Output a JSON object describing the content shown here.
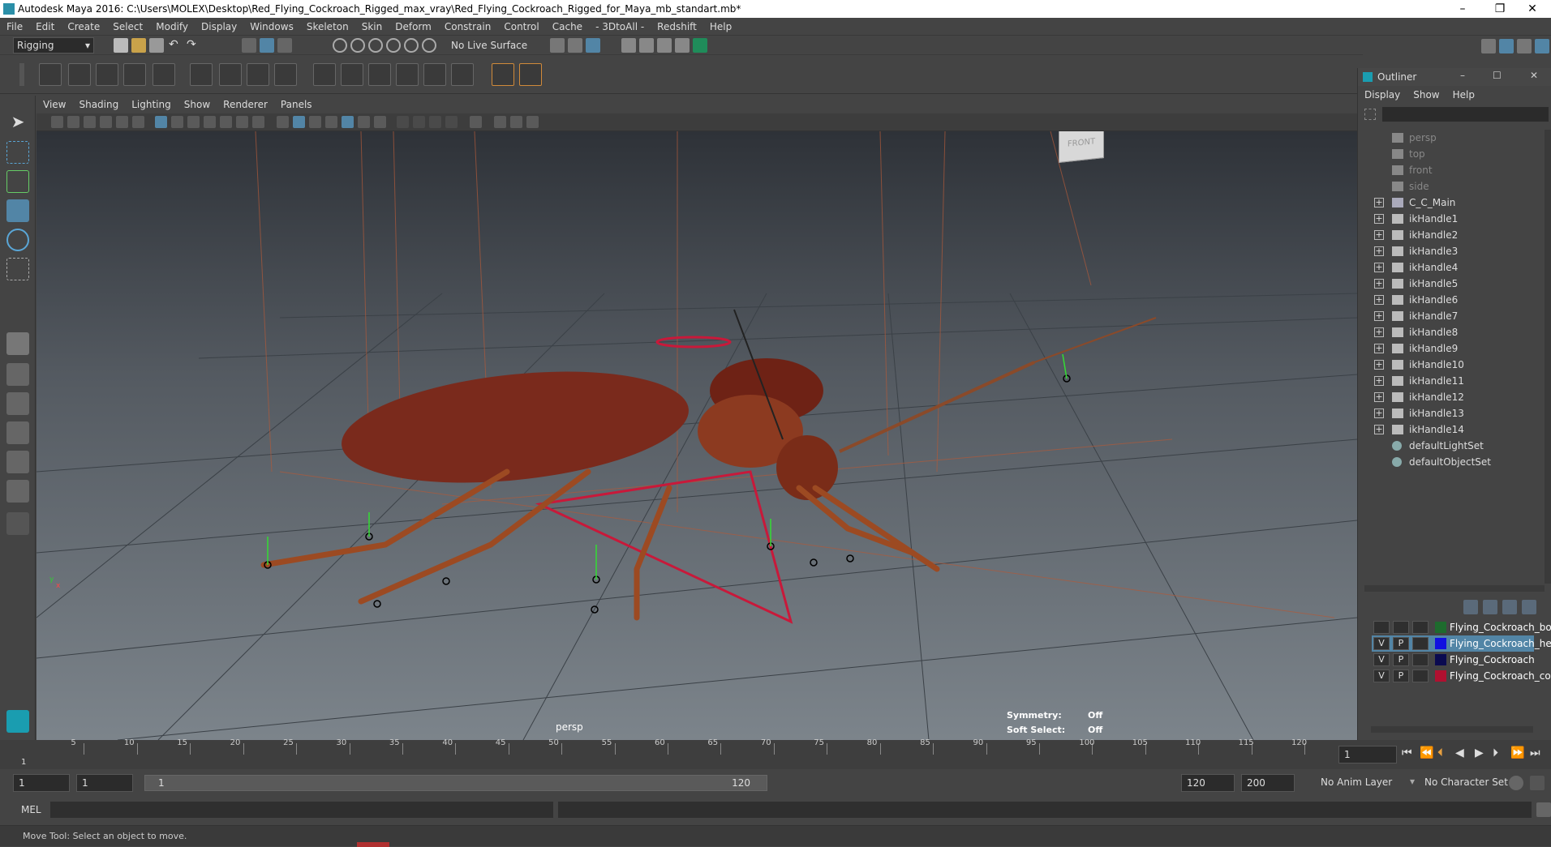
{
  "window": {
    "title": "Autodesk Maya 2016: C:\\Users\\MOLEX\\Desktop\\Red_Flying_Cockroach_Rigged_max_vray\\Red_Flying_Cockroach_Rigged_for_Maya_mb_standart.mb*",
    "minimize": "–",
    "restore": "❐",
    "close": "✕"
  },
  "menubar": [
    "File",
    "Edit",
    "Create",
    "Select",
    "Modify",
    "Display",
    "Windows",
    "Skeleton",
    "Skin",
    "Deform",
    "Constrain",
    "Control",
    "Cache",
    "- 3DtoAll -",
    "Redshift",
    "Help"
  ],
  "statusline": {
    "mode": "Rigging",
    "live_surface": "No Live Surface"
  },
  "viewport": {
    "menu": [
      "View",
      "Shading",
      "Lighting",
      "Show",
      "Renderer",
      "Panels"
    ],
    "camera_label": "persp",
    "viewcube_label": "FRONT",
    "hud": {
      "symmetry_label": "Symmetry:",
      "symmetry_value": "Off",
      "soft_select_label": "Soft Select:",
      "soft_select_value": "Off"
    }
  },
  "outliner": {
    "title": "Outliner",
    "menu": [
      "Display",
      "Show",
      "Help"
    ],
    "items": [
      {
        "label": "persp",
        "dim": true,
        "expandable": false,
        "icon": "camera-icon"
      },
      {
        "label": "top",
        "dim": true,
        "expandable": false,
        "icon": "camera-icon"
      },
      {
        "label": "front",
        "dim": true,
        "expandable": false,
        "icon": "camera-icon"
      },
      {
        "label": "side",
        "dim": true,
        "expandable": false,
        "icon": "camera-icon"
      },
      {
        "label": "C_C_Main",
        "dim": false,
        "expandable": true,
        "icon": "joint-icon"
      },
      {
        "label": "ikHandle1",
        "dim": false,
        "expandable": true,
        "icon": "ik-handle-icon"
      },
      {
        "label": "ikHandle2",
        "dim": false,
        "expandable": true,
        "icon": "ik-handle-icon"
      },
      {
        "label": "ikHandle3",
        "dim": false,
        "expandable": true,
        "icon": "ik-handle-icon"
      },
      {
        "label": "ikHandle4",
        "dim": false,
        "expandable": true,
        "icon": "ik-handle-icon"
      },
      {
        "label": "ikHandle5",
        "dim": false,
        "expandable": true,
        "icon": "ik-handle-icon"
      },
      {
        "label": "ikHandle6",
        "dim": false,
        "expandable": true,
        "icon": "ik-handle-icon"
      },
      {
        "label": "ikHandle7",
        "dim": false,
        "expandable": true,
        "icon": "ik-handle-icon"
      },
      {
        "label": "ikHandle8",
        "dim": false,
        "expandable": true,
        "icon": "ik-handle-icon"
      },
      {
        "label": "ikHandle9",
        "dim": false,
        "expandable": true,
        "icon": "ik-handle-icon"
      },
      {
        "label": "ikHandle10",
        "dim": false,
        "expandable": true,
        "icon": "ik-handle-icon"
      },
      {
        "label": "ikHandle11",
        "dim": false,
        "expandable": true,
        "icon": "ik-handle-icon"
      },
      {
        "label": "ikHandle12",
        "dim": false,
        "expandable": true,
        "icon": "ik-handle-icon"
      },
      {
        "label": "ikHandle13",
        "dim": false,
        "expandable": true,
        "icon": "ik-handle-icon"
      },
      {
        "label": "ikHandle14",
        "dim": false,
        "expandable": true,
        "icon": "ik-handle-icon"
      },
      {
        "label": "defaultLightSet",
        "dim": false,
        "expandable": false,
        "icon": "set-icon"
      },
      {
        "label": "defaultObjectSet",
        "dim": false,
        "expandable": false,
        "icon": "set-icon"
      }
    ]
  },
  "layers": [
    {
      "v": "",
      "p": "",
      "color": "#1e6b2e",
      "name": "Flying_Cockroach_bon",
      "selected": false
    },
    {
      "v": "V",
      "p": "P",
      "color": "#1010e0",
      "name": "Flying_Cockroach_help",
      "selected": true
    },
    {
      "v": "V",
      "p": "P",
      "color": "#0a0a50",
      "name": "Flying_Cockroach",
      "selected": false
    },
    {
      "v": "V",
      "p": "P",
      "color": "#b01030",
      "name": "Flying_Cockroach_con",
      "selected": false
    }
  ],
  "timeline": {
    "ticks": [
      "5",
      "10",
      "15",
      "20",
      "25",
      "30",
      "35",
      "40",
      "45",
      "50",
      "55",
      "60",
      "65",
      "70",
      "75",
      "80",
      "85",
      "90",
      "95",
      "100",
      "105",
      "110",
      "115",
      "120"
    ],
    "start_tick": "1",
    "current_frame": "1"
  },
  "range": {
    "start": "1",
    "playback_start": "1",
    "slider_start": "1",
    "slider_end": "120",
    "playback_end": "120",
    "end": "200",
    "anim_layer": "No Anim Layer",
    "character_set": "No Character Set"
  },
  "mel": {
    "label": "MEL"
  },
  "help_line": "Move Tool: Select an object to move.",
  "colors": {
    "accent": "#5285a6",
    "maya_teal": "#1a9db0"
  }
}
